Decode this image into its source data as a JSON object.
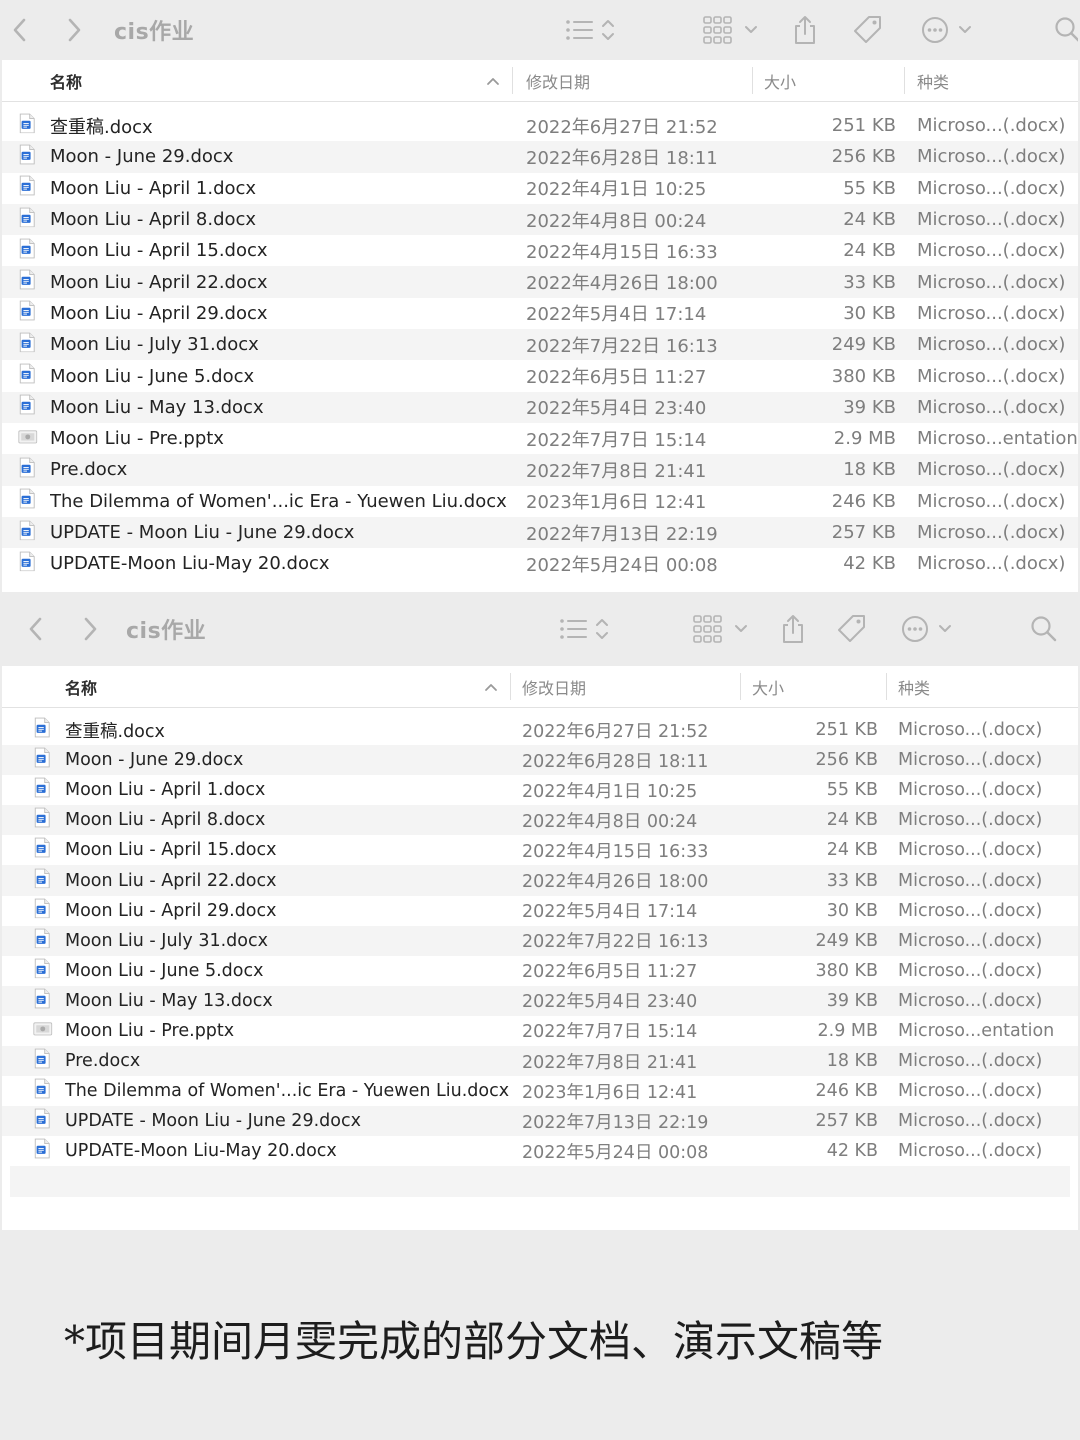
{
  "window_title": "cis作业",
  "header": {
    "name": "名称",
    "date": "修改日期",
    "size": "大小",
    "kind": "种类"
  },
  "files": [
    {
      "name": "查重稿.docx",
      "date": "2022年6月27日 21:52",
      "size": "251 KB",
      "kind": "Microso...(.docx)",
      "type": "docx"
    },
    {
      "name": "Moon - June 29.docx",
      "date": "2022年6月28日 18:11",
      "size": "256 KB",
      "kind": "Microso...(.docx)",
      "type": "docx"
    },
    {
      "name": "Moon Liu - April 1.docx",
      "date": "2022年4月1日 10:25",
      "size": "55 KB",
      "kind": "Microso...(.docx)",
      "type": "docx"
    },
    {
      "name": "Moon Liu - April 8.docx",
      "date": "2022年4月8日 00:24",
      "size": "24 KB",
      "kind": "Microso...(.docx)",
      "type": "docx"
    },
    {
      "name": "Moon Liu - April 15.docx",
      "date": "2022年4月15日 16:33",
      "size": "24 KB",
      "kind": "Microso...(.docx)",
      "type": "docx"
    },
    {
      "name": "Moon Liu - April 22.docx",
      "date": "2022年4月26日 18:00",
      "size": "33 KB",
      "kind": "Microso...(.docx)",
      "type": "docx"
    },
    {
      "name": "Moon Liu - April 29.docx",
      "date": "2022年5月4日 17:14",
      "size": "30 KB",
      "kind": "Microso...(.docx)",
      "type": "docx"
    },
    {
      "name": "Moon Liu - July 31.docx",
      "date": "2022年7月22日 16:13",
      "size": "249 KB",
      "kind": "Microso...(.docx)",
      "type": "docx"
    },
    {
      "name": "Moon Liu - June 5.docx",
      "date": "2022年6月5日 11:27",
      "size": "380 KB",
      "kind": "Microso...(.docx)",
      "type": "docx"
    },
    {
      "name": "Moon Liu - May 13.docx",
      "date": "2022年5月4日 23:40",
      "size": "39 KB",
      "kind": "Microso...(.docx)",
      "type": "docx"
    },
    {
      "name": "Moon Liu - Pre.pptx",
      "date": "2022年7月7日 15:14",
      "size": "2.9 MB",
      "kind": "Microso...entation",
      "type": "pptx"
    },
    {
      "name": "Pre.docx",
      "date": "2022年7月8日 21:41",
      "size": "18 KB",
      "kind": "Microso...(.docx)",
      "type": "docx"
    },
    {
      "name": "The Dilemma of Women'...ic Era - Yuewen Liu.docx",
      "date": "2023年1月6日 12:41",
      "size": "246 KB",
      "kind": "Microso...(.docx)",
      "type": "docx"
    },
    {
      "name": "UPDATE - Moon Liu - June 29.docx",
      "date": "2022年7月13日 22:19",
      "size": "257 KB",
      "kind": "Microso...(.docx)",
      "type": "docx"
    },
    {
      "name": "UPDATE-Moon Liu-May 20.docx",
      "date": "2022年5月24日 00:08",
      "size": "42 KB",
      "kind": "Microso...(.docx)",
      "type": "docx"
    }
  ],
  "caption": "*项目期间月雯完成的部分文档、演示文稿等",
  "icons": {
    "back": "chevron-left-icon",
    "forward": "chevron-right-icon",
    "view": "list-view-icon",
    "group": "grid-group-icon",
    "share": "share-icon",
    "tag": "tag-icon",
    "more": "ellipsis-circle-icon",
    "search": "search-icon"
  },
  "colors": {
    "docx_icon": "#2b6fd6",
    "toolbar_bg": "#ececec",
    "row_alt": "#f4f4f4",
    "icon_grey": "#b4b4b4"
  }
}
